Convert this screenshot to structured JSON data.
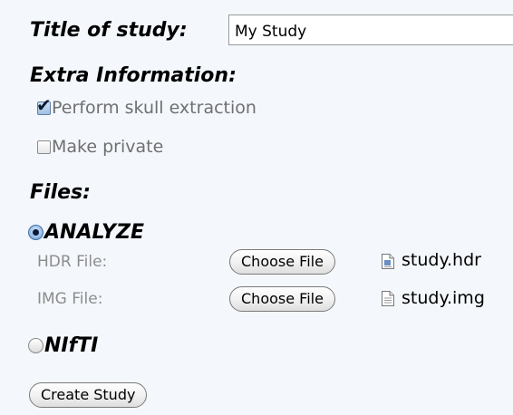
{
  "form": {
    "title_label": "Title of study:",
    "title_value": "My Study",
    "extra_heading": "Extra Information:",
    "options": [
      {
        "label": "Perform skull extraction",
        "checked": true
      },
      {
        "label": "Make private",
        "checked": false
      }
    ],
    "files_heading": "Files:",
    "formats": [
      {
        "label": "ANALYZE",
        "selected": true
      },
      {
        "label": "NIfTI",
        "selected": false
      }
    ],
    "analyze_files": [
      {
        "label": "HDR File:",
        "button_label": "Choose File",
        "file_name": "study.hdr",
        "icon": "document-icon"
      },
      {
        "label": "IMG File:",
        "button_label": "Choose File",
        "file_name": "study.img",
        "icon": "document-icon"
      }
    ],
    "submit_label": "Create Study"
  }
}
